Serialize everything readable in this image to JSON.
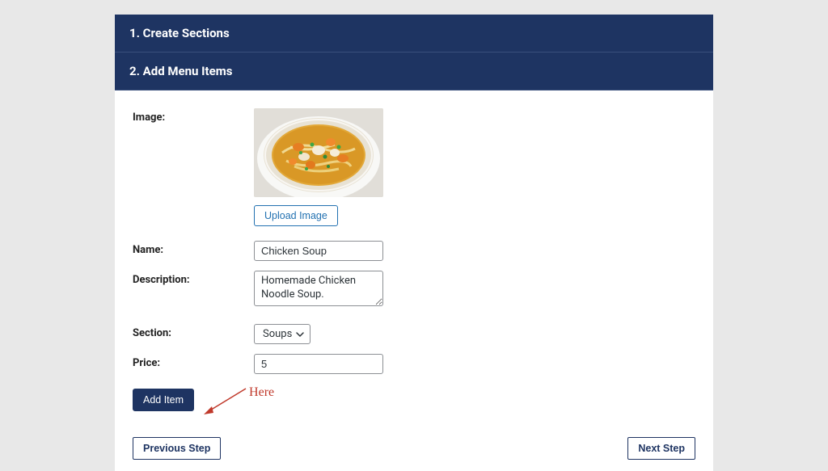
{
  "steps": {
    "step1": "1. Create Sections",
    "step2": "2. Add Menu Items"
  },
  "form": {
    "image_label": "Image:",
    "upload_button": "Upload Image",
    "name_label": "Name:",
    "name_value": "Chicken Soup",
    "description_label": "Description:",
    "description_value": "Homemade Chicken Noodle Soup.",
    "section_label": "Section:",
    "section_selected": "Soups",
    "price_label": "Price:",
    "price_value": "5",
    "add_button": "Add Item"
  },
  "annotation": {
    "text": "Here"
  },
  "nav": {
    "previous": "Previous Step",
    "next": "Next Step"
  }
}
